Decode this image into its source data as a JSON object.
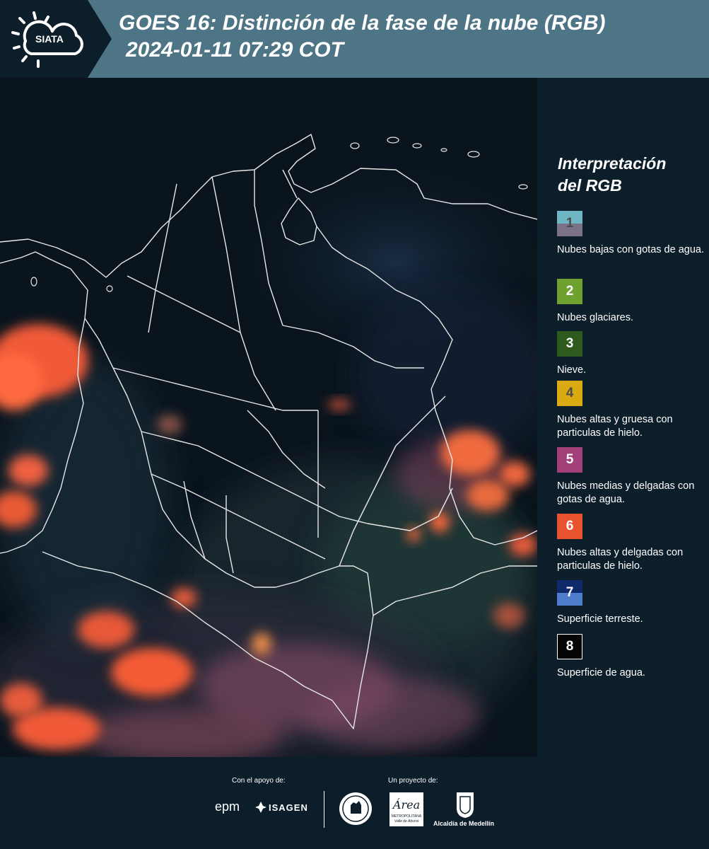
{
  "header": {
    "logo_text": "SIATA",
    "title_line1": "GOES 16: Distinción de la fase de la nube (RGB)",
    "title_line2": "2024-01-11 07:29 COT"
  },
  "legend": {
    "title_line1": "Interpretación",
    "title_line2": "del RGB",
    "items": [
      {
        "number": "1",
        "label": "Nubes bajas con gotas de agua.",
        "color_top": "#6fb6c4",
        "color_bottom": "#7a7388",
        "text_color": "#4b4b4b"
      },
      {
        "number": "2",
        "label": "Nubes glaciares.",
        "color_top": "#6fa130",
        "color_bottom": "#6fa130",
        "text_color": "#ffffff"
      },
      {
        "number": "3",
        "label": "Nieve.",
        "color_top": "#2e5a1d",
        "color_bottom": "#2e5a1d",
        "text_color": "#ffffff"
      },
      {
        "number": "4",
        "label": "Nubes altas y gruesa con particulas de hielo.",
        "color_top": "#d9aa12",
        "color_bottom": "#d9aa12",
        "text_color": "#4b4b4b"
      },
      {
        "number": "5",
        "label": "Nubes medias y delgadas con gotas de agua.",
        "color_top": "#a2407a",
        "color_bottom": "#a2407a",
        "text_color": "#ffffff"
      },
      {
        "number": "6",
        "label": "Nubes altas y delgadas con particulas de hielo.",
        "color_top": "#e8532f",
        "color_bottom": "#e8532f",
        "text_color": "#ffffff"
      },
      {
        "number": "7",
        "label": "Superficie terreste.",
        "color_top": "#0e2a6b",
        "color_bottom": "#4e7dcc",
        "text_color": "#ffffff"
      },
      {
        "number": "8",
        "label": "Superficie de agua.",
        "color_top": "#050505",
        "color_bottom": "#050505",
        "text_color": "#ffffff",
        "border": "#ffffff"
      }
    ]
  },
  "footer": {
    "support_caption": "Con el apoyo de:",
    "project_caption": "Un proyecto de:",
    "sponsor_epm": "epm",
    "sponsor_isagen": "ISAGEN",
    "partner_area_name": "Área",
    "partner_area_sub1": "METROPOLITANA",
    "partner_area_sub2": "Valle de Aburrá",
    "partner_alcaldia": "Alcaldía de Medellín"
  }
}
